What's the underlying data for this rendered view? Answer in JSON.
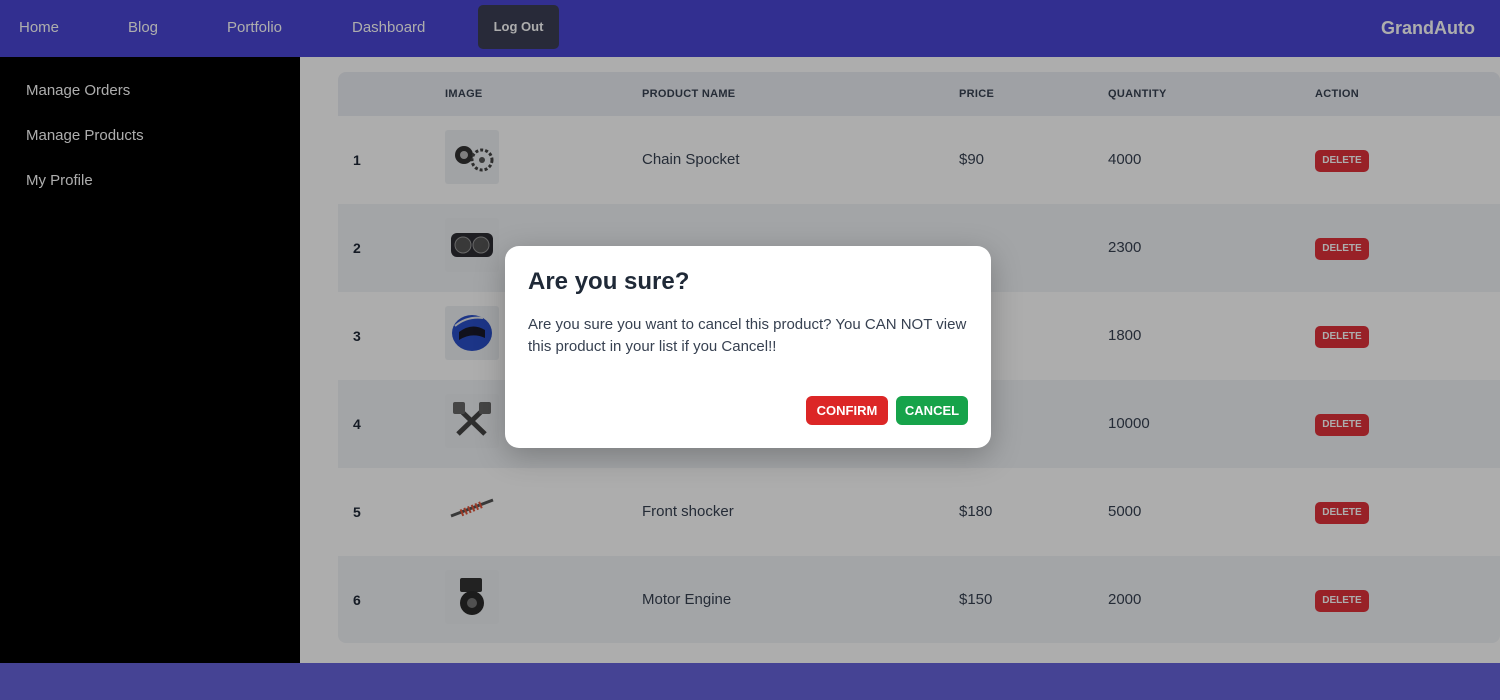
{
  "nav": {
    "links": [
      "Home",
      "Blog",
      "Portfolio",
      "Dashboard"
    ],
    "logout_label": "Log Out",
    "brand": "GrandAuto"
  },
  "sidebar": {
    "items": [
      {
        "label": "Manage Orders"
      },
      {
        "label": "Manage Products"
      },
      {
        "label": "My Profile"
      }
    ]
  },
  "table": {
    "headers": {
      "index": "",
      "image": "IMAGE",
      "name": "PRODUCT NAME",
      "price": "PRICE",
      "quantity": "QUANTITY",
      "action": "ACTION"
    },
    "rows": [
      {
        "num": "1",
        "name": "Chain Spocket",
        "price": "$90",
        "quantity": "4000",
        "action": "DELETE",
        "image_icon": "chain-sprocket-icon"
      },
      {
        "num": "2",
        "name": "",
        "price": "",
        "quantity": "2300",
        "action": "DELETE",
        "image_icon": "speedometer-icon"
      },
      {
        "num": "3",
        "name": "",
        "price": "",
        "quantity": "1800",
        "action": "DELETE",
        "image_icon": "helmet-icon"
      },
      {
        "num": "4",
        "name": "",
        "price": "",
        "quantity": "10000",
        "action": "DELETE",
        "image_icon": "pistons-icon"
      },
      {
        "num": "5",
        "name": "Front shocker",
        "price": "$180",
        "quantity": "5000",
        "action": "DELETE",
        "image_icon": "shock-absorber-icon"
      },
      {
        "num": "6",
        "name": "Motor Engine",
        "price": "$150",
        "quantity": "2000",
        "action": "DELETE",
        "image_icon": "engine-icon"
      }
    ]
  },
  "modal": {
    "title": "Are you sure?",
    "message": "Are you sure you want to cancel this product? You CAN NOT view this product in your list if you Cancel!!",
    "confirm_label": "CONFIRM",
    "cancel_label": "CANCEL"
  },
  "colors": {
    "navbar": "#4a46d4",
    "sidebar": "#000000",
    "delete": "#e0323a",
    "confirm": "#dc2626",
    "cancel": "#16a34a"
  }
}
